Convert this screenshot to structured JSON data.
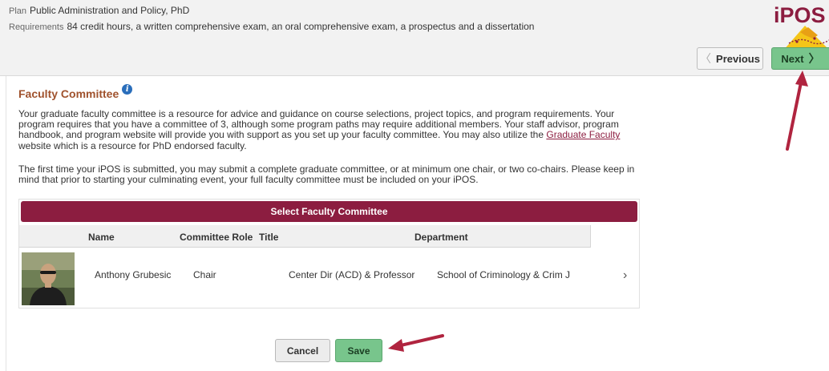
{
  "header": {
    "plan_label": "Plan",
    "plan_value": "Public Administration and Policy, PhD",
    "requirements_label": "Requirements",
    "requirements_value": "84 credit hours, a written comprehensive exam, an oral comprehensive exam, a prospectus and a dissertation",
    "logo_text": "iPOS"
  },
  "nav": {
    "previous_label": "Previous",
    "next_label": "Next"
  },
  "section": {
    "title": "Faculty Committee",
    "info_icon": "info-icon",
    "para1_before_link": "Your graduate faculty committee is a resource for advice and guidance on course selections, project topics, and program requirements. Your program requires that you have a committee of 3, although some program paths may require additional members. Your staff advisor, program handbook, and program website will provide you with support as you set up your faculty committee. You may also utilize the ",
    "para1_link": "Graduate Faculty",
    "para1_after_link": " website which is a resource for PhD endorsed faculty.",
    "para2": "The first time your iPOS is submitted, you may submit a complete graduate committee, or at minimum one chair, or two co-chairs. Please keep in mind that prior to starting your culminating event, your full faculty committee must be included on your iPOS."
  },
  "grid": {
    "title": "Select Faculty Committee",
    "columns": [
      "Name",
      "Committee Role",
      "Title",
      "Department"
    ],
    "rows": [
      {
        "name": "Anthony Grubesic",
        "role": "Chair",
        "title": "Center Dir (ACD) & Professor",
        "department": "School of Criminology & Crim J"
      }
    ]
  },
  "footer": {
    "cancel_label": "Cancel",
    "save_label": "Save"
  },
  "colors": {
    "maroon": "#8c1d40",
    "green_button": "#78c58c",
    "title_color": "#a0522d",
    "arrow": "#b0243f"
  }
}
